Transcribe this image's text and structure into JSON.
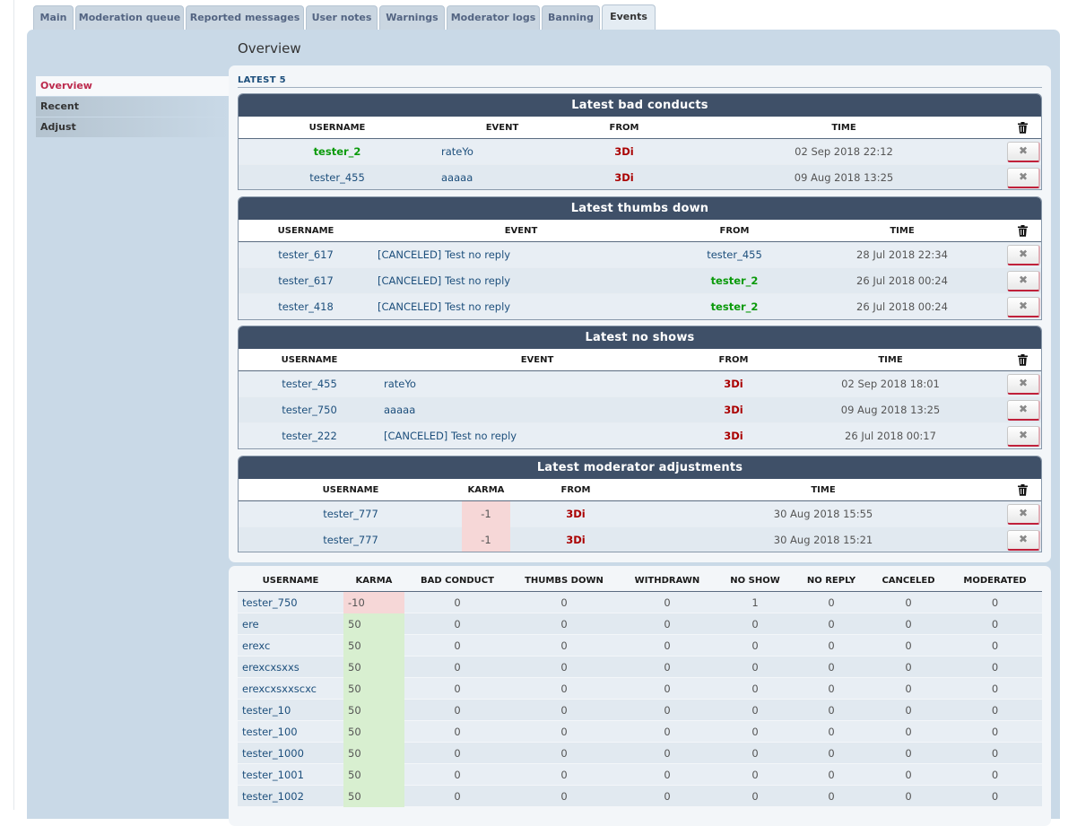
{
  "tabs": [
    "Main",
    "Moderation queue",
    "Reported messages",
    "User notes",
    "Warnings",
    "Moderator logs",
    "Banning",
    "Events"
  ],
  "active_tab": "Events",
  "page_title": "Overview",
  "side_menu": [
    "Overview",
    "Recent",
    "Adjust"
  ],
  "latest_label": "LATEST 5",
  "bad_conducts": {
    "title": "Latest bad conducts",
    "columns": [
      "USERNAME",
      "EVENT",
      "FROM",
      "TIME"
    ],
    "rows": [
      {
        "username": "tester_2",
        "event": "rateYo",
        "from": "3Di",
        "time": "02 Sep 2018 22:12"
      },
      {
        "username": "tester_455",
        "event": "aaaaa",
        "from": "3Di",
        "time": "09 Aug 2018 13:25"
      }
    ]
  },
  "thumbs_down": {
    "title": "Latest thumbs down",
    "columns": [
      "USERNAME",
      "EVENT",
      "FROM",
      "TIME"
    ],
    "rows": [
      {
        "username": "tester_617",
        "event": "[CANCELED] Test no reply",
        "from": "tester_455",
        "time": "28 Jul 2018 22:34"
      },
      {
        "username": "tester_617",
        "event": "[CANCELED] Test no reply",
        "from": "tester_2",
        "time": "26 Jul 2018 00:24"
      },
      {
        "username": "tester_418",
        "event": "[CANCELED] Test no reply",
        "from": "tester_2",
        "time": "26 Jul 2018 00:24"
      }
    ]
  },
  "no_shows": {
    "title": "Latest no shows",
    "columns": [
      "USERNAME",
      "EVENT",
      "FROM",
      "TIME"
    ],
    "rows": [
      {
        "username": "tester_455",
        "event": "rateYo",
        "from": "3Di",
        "time": "02 Sep 2018 18:01"
      },
      {
        "username": "tester_750",
        "event": "aaaaa",
        "from": "3Di",
        "time": "09 Aug 2018 13:25"
      },
      {
        "username": "tester_222",
        "event": "[CANCELED] Test no reply",
        "from": "3Di",
        "time": "26 Jul 2018 00:17"
      }
    ]
  },
  "mod_adjustments": {
    "title": "Latest moderator adjustments",
    "columns": [
      "USERNAME",
      "KARMA",
      "FROM",
      "TIME"
    ],
    "rows": [
      {
        "username": "tester_777",
        "karma": "-1",
        "from": "3Di",
        "time": "30 Aug 2018 15:55"
      },
      {
        "username": "tester_777",
        "karma": "-1",
        "from": "3Di",
        "time": "30 Aug 2018 15:21"
      }
    ]
  },
  "delete_label": "✖",
  "karma_table": {
    "columns": [
      "USERNAME",
      "KARMA",
      "BAD CONDUCT",
      "THUMBS DOWN",
      "WITHDRAWN",
      "NO SHOW",
      "NO REPLY",
      "CANCELED",
      "MODERATED"
    ],
    "rows": [
      [
        "tester_750",
        "-10",
        "0",
        "0",
        "0",
        "1",
        "0",
        "0",
        "0"
      ],
      [
        "ere",
        "50",
        "0",
        "0",
        "0",
        "0",
        "0",
        "0",
        "0"
      ],
      [
        "erexc",
        "50",
        "0",
        "0",
        "0",
        "0",
        "0",
        "0",
        "0"
      ],
      [
        "erexcxsxxs",
        "50",
        "0",
        "0",
        "0",
        "0",
        "0",
        "0",
        "0"
      ],
      [
        "erexcxsxxscxc",
        "50",
        "0",
        "0",
        "0",
        "0",
        "0",
        "0",
        "0"
      ],
      [
        "tester_10",
        "50",
        "0",
        "0",
        "0",
        "0",
        "0",
        "0",
        "0"
      ],
      [
        "tester_100",
        "50",
        "0",
        "0",
        "0",
        "0",
        "0",
        "0",
        "0"
      ],
      [
        "tester_1000",
        "50",
        "0",
        "0",
        "0",
        "0",
        "0",
        "0",
        "0"
      ],
      [
        "tester_1001",
        "50",
        "0",
        "0",
        "0",
        "0",
        "0",
        "0",
        "0"
      ],
      [
        "tester_1002",
        "50",
        "0",
        "0",
        "0",
        "0",
        "0",
        "0",
        "0"
      ]
    ]
  }
}
